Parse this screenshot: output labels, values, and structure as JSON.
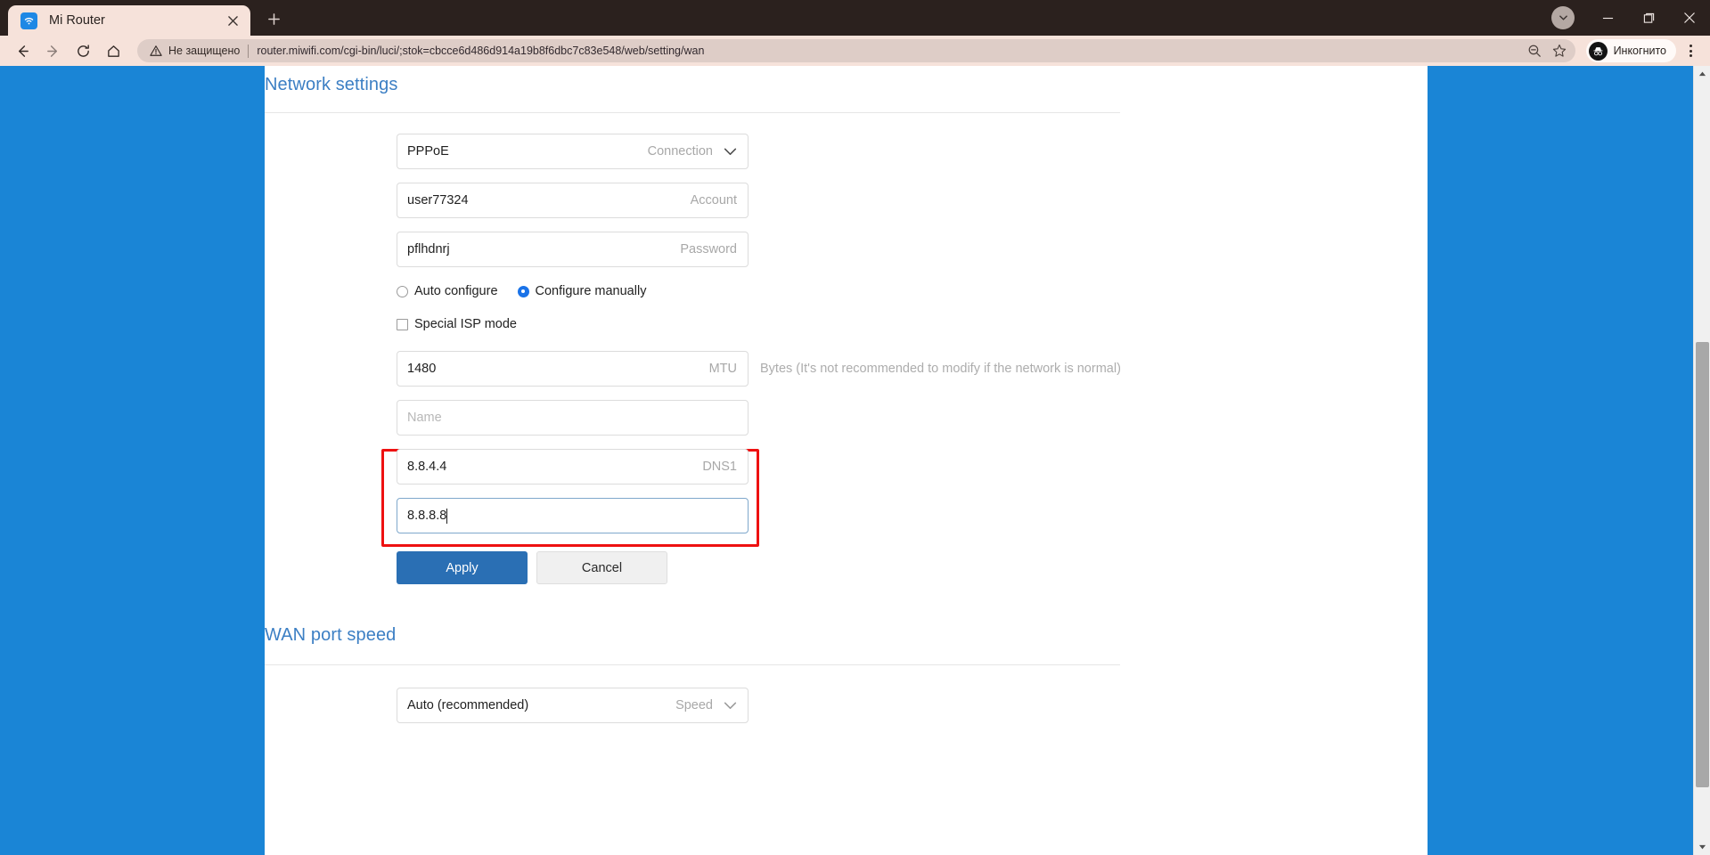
{
  "browser": {
    "tab": {
      "title": "Mi Router",
      "favicon_icon": "wifi-icon",
      "close_icon": "close-icon"
    },
    "new_tab_icon": "plus-icon",
    "tab_search_icon": "chevron-down-circle-icon",
    "window_controls": {
      "minimize_icon": "minimize-icon",
      "maximize_icon": "maximize-icon",
      "close_icon": "window-close-icon"
    },
    "toolbar": {
      "back_icon": "arrow-left-icon",
      "forward_icon": "arrow-right-icon",
      "reload_icon": "reload-icon",
      "home_icon": "home-icon",
      "security_icon": "warning-triangle-icon",
      "security_label": "Не защищено",
      "url": "router.miwifi.com/cgi-bin/luci/;stok=cbcce6d486d914a19b8f6dbc7c83e548/web/setting/wan",
      "zoom_icon": "zoom-out-icon",
      "bookmark_icon": "star-icon",
      "incognito_icon": "incognito-icon",
      "incognito_label": "Инкогнито",
      "menu_icon": "three-dots-icon"
    }
  },
  "page": {
    "accent_color": "#1a85d6",
    "heading_color": "#3c7fc4",
    "highlight_color": "#ee1111",
    "network_settings": {
      "title": "Network settings",
      "connection": {
        "value": "PPPoE",
        "label": "Connection",
        "chevron_icon": "chevron-down-icon"
      },
      "account": {
        "value": "user77324",
        "label": "Account"
      },
      "password": {
        "value": "pflhdnrj",
        "label": "Password"
      },
      "radios": [
        {
          "label": "Auto configure",
          "selected": false
        },
        {
          "label": "Configure manually",
          "selected": true
        }
      ],
      "special_isp": {
        "label": "Special ISP mode",
        "checked": false
      },
      "mtu": {
        "value": "1480",
        "label": "MTU",
        "hint": "Bytes (It's not recommended to modify if the network is normal)"
      },
      "name": {
        "value": "",
        "placeholder": "Name"
      },
      "dns1": {
        "value": "8.8.4.4",
        "label": "DNS1"
      },
      "dns2": {
        "value": "8.8.8.8",
        "label": "",
        "focused": true
      },
      "apply_label": "Apply",
      "cancel_label": "Cancel"
    },
    "wan_port_speed": {
      "title": "WAN port speed",
      "speed": {
        "value": "Auto (recommended)",
        "label": "Speed",
        "chevron_icon": "chevron-down-icon"
      }
    }
  },
  "scrollbar": {
    "up_icon": "triangle-up-icon",
    "down_icon": "triangle-down-icon"
  }
}
